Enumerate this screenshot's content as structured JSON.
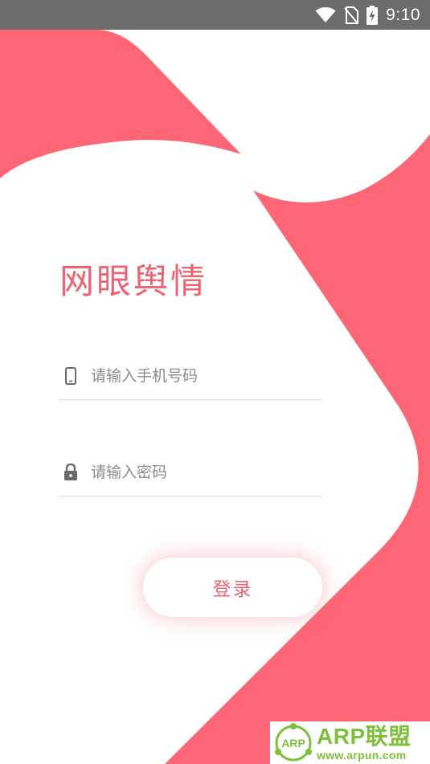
{
  "status_bar": {
    "time": "9:10"
  },
  "app": {
    "title": "网眼舆情"
  },
  "form": {
    "phone_placeholder": "请输入手机号码",
    "password_placeholder": "请输入密码",
    "login_label": "登录"
  },
  "watermark": {
    "brand": "ARP联盟",
    "url": "www.arpun.com",
    "logo_text": "ARP"
  },
  "colors": {
    "accent": "#ff6675",
    "title": "#ec6472",
    "status_bar": "#6c6c6c",
    "watermark_green": "#7dc13a"
  },
  "icons": {
    "status": [
      "wifi-icon",
      "no-sim-icon",
      "battery-charging-icon"
    ],
    "phone_field": "smartphone-icon",
    "password_field": "lock-icon"
  }
}
